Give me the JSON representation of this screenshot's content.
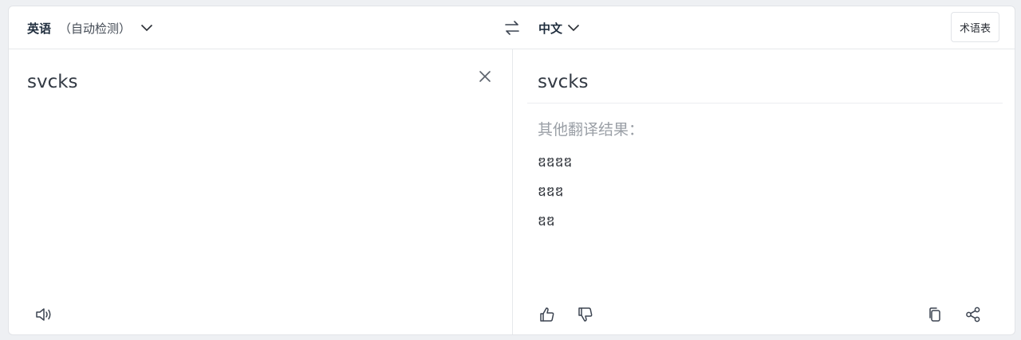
{
  "header": {
    "source_language": "英语",
    "auto_detect": "（自动检测）",
    "target_language": "中文",
    "glossary_label": "术语表"
  },
  "source": {
    "text": "svcks"
  },
  "result": {
    "main": "svcks",
    "other_title": "其他翻译结果：",
    "alternatives": [
      "ឌឌឌឌ",
      "ឌឌឌ",
      "ឌឌ"
    ]
  },
  "icons": {
    "swap": "swap-icon",
    "clear": "close-icon",
    "speaker": "speaker-icon",
    "like": "thumbs-up-icon",
    "dislike": "thumbs-down-icon",
    "copy": "copy-icon",
    "share": "share-icon"
  },
  "colors": {
    "icon": "#3b4350",
    "muted_text": "#9a9fa6",
    "border": "#e6e8eb"
  }
}
